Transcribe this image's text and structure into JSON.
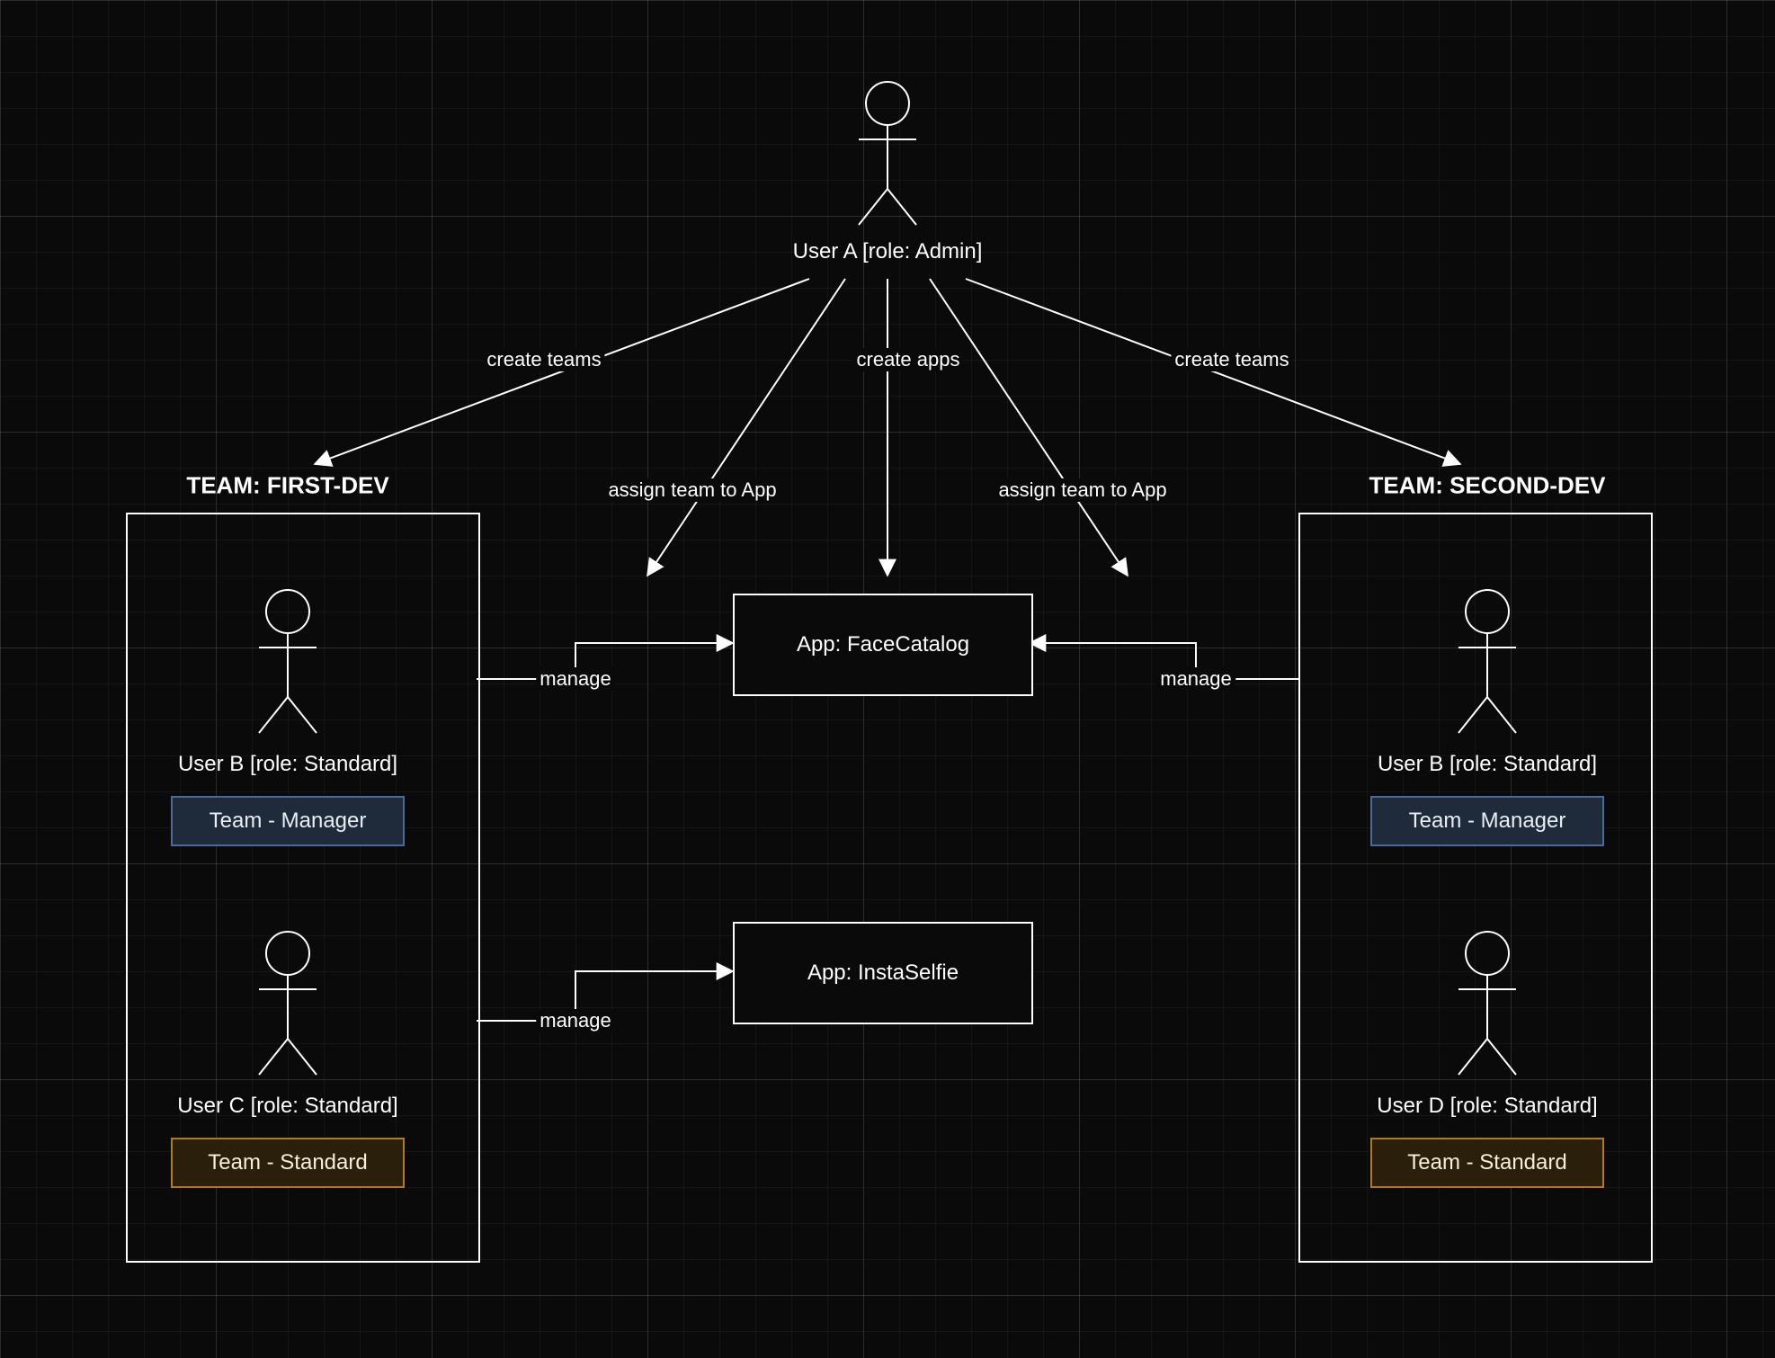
{
  "actors": {
    "admin": {
      "label": "User A [role: Admin]"
    },
    "team1_user_top": {
      "label": "User B [role: Standard]"
    },
    "team1_user_bottom": {
      "label": "User C [role: Standard]"
    },
    "team2_user_top": {
      "label": "User B [role: Standard]"
    },
    "team2_user_bottom": {
      "label": "User D [role: Standard]"
    }
  },
  "teams": {
    "first": {
      "title": "TEAM: FIRST-DEV"
    },
    "second": {
      "title": "TEAM: SECOND-DEV"
    }
  },
  "apps": {
    "app1": {
      "label": "App: FaceCatalog"
    },
    "app2": {
      "label": "App: InstaSelfie"
    }
  },
  "roles": {
    "manager": "Team - Manager",
    "standard": "Team - Standard"
  },
  "edges": {
    "create_teams": "create teams",
    "create_apps": "create apps",
    "assign_team": "assign team to App",
    "manage": "manage"
  }
}
